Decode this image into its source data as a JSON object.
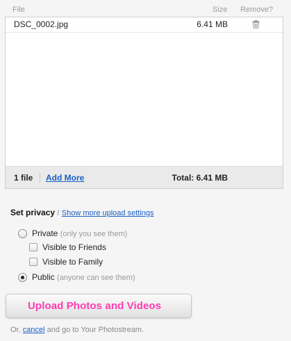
{
  "table": {
    "headers": {
      "file": "File",
      "size": "Size",
      "remove": "Remove?"
    },
    "rows": [
      {
        "name": "DSC_0002.jpg",
        "size": "6.41 MB",
        "remove_icon": "trash-icon"
      }
    ],
    "footer": {
      "count": "1 file",
      "add_more": "Add More",
      "total": "Total: 6.41 MB"
    }
  },
  "privacy": {
    "title": "Set privacy",
    "separator": "/",
    "more_settings_link": "Show more upload settings",
    "options": {
      "private": {
        "label": "Private",
        "hint": "(only you see them)",
        "selected": false
      },
      "friends": {
        "label": "Visible to Friends",
        "checked": false
      },
      "family": {
        "label": "Visible to Family",
        "checked": false
      },
      "public": {
        "label": "Public",
        "hint": "(anyone can see them)",
        "selected": true
      }
    }
  },
  "upload_button": {
    "label": "Upload Photos and Videos",
    "color": "#ff3cb1"
  },
  "bottom": {
    "prefix": "Or,",
    "cancel": "cancel",
    "suffix": "and go to Your Photostream."
  }
}
